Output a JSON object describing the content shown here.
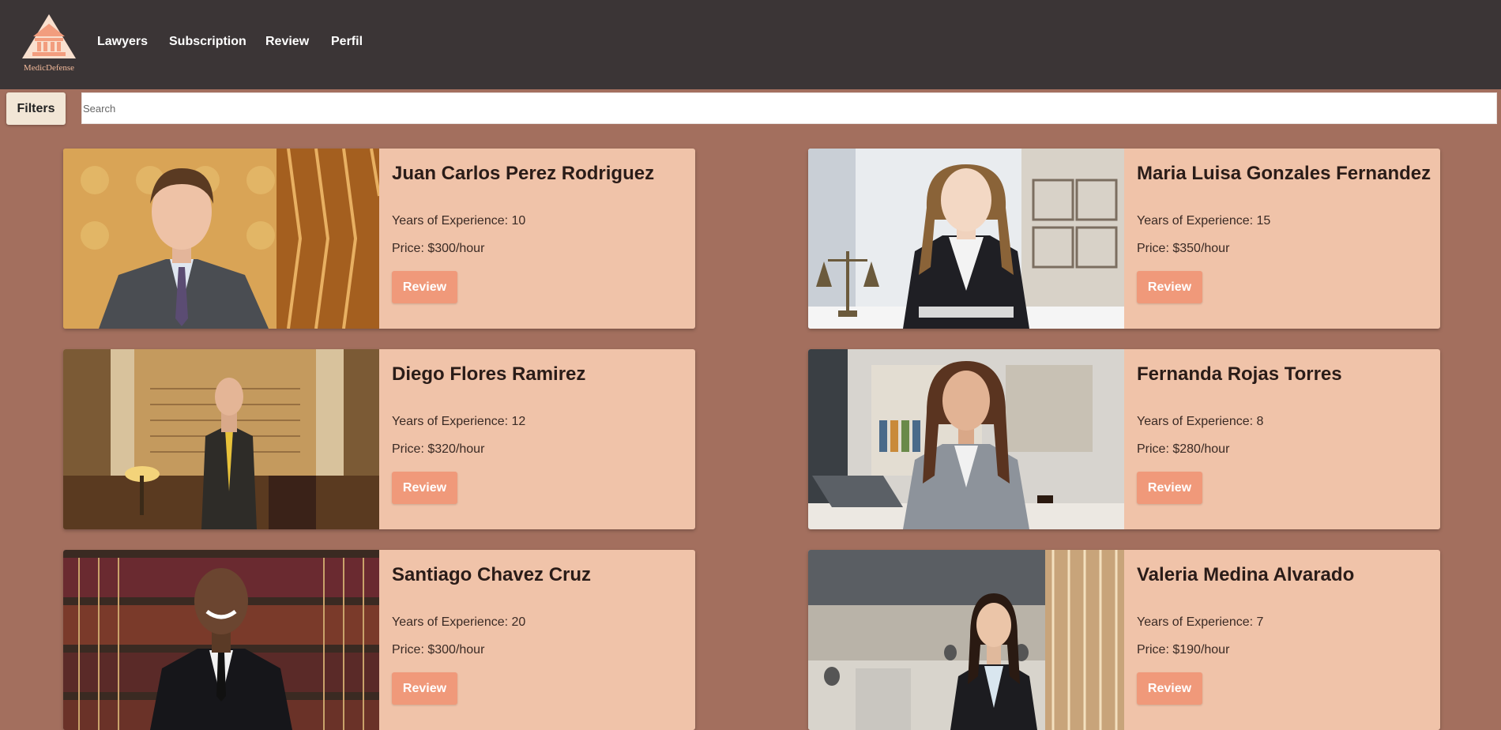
{
  "navbar": {
    "logo_text": "MedicDefense",
    "links": [
      "Lawyers",
      "Subscription",
      "Review",
      "Perfil"
    ]
  },
  "toolbar": {
    "filters_label": "Filters",
    "search_placeholder": "Search",
    "search_value": ""
  },
  "lawyers": [
    {
      "name": "Juan Carlos Perez Rodriguez",
      "experience": "Years of Experience: 10",
      "price": "Price: $300/hour",
      "review_label": "Review"
    },
    {
      "name": "Maria Luisa Gonzales Fernandez",
      "experience": "Years of Experience: 15",
      "price": "Price: $350/hour",
      "review_label": "Review"
    },
    {
      "name": "Diego Flores Ramirez",
      "experience": "Years of Experience: 12",
      "price": "Price: $320/hour",
      "review_label": "Review"
    },
    {
      "name": "Fernanda Rojas Torres",
      "experience": "Years of Experience: 8",
      "price": "Price: $280/hour",
      "review_label": "Review"
    },
    {
      "name": "Santiago Chavez Cruz",
      "experience": "Years of Experience: 20",
      "price": "Price: $300/hour",
      "review_label": "Review"
    },
    {
      "name": "Valeria Medina Alvarado",
      "experience": "Years of Experience: 7",
      "price": "Price: $190/hour",
      "review_label": "Review"
    }
  ],
  "colors": {
    "navbar_bg": "#3b3536",
    "page_bg": "#a36f5e",
    "card_bg": "#f0c3a9",
    "review_button": "#f0997a",
    "filters_button": "#f2e6d6",
    "logo_accent": "#f2b99a"
  },
  "icons": {
    "logo": "courthouse-icon"
  }
}
